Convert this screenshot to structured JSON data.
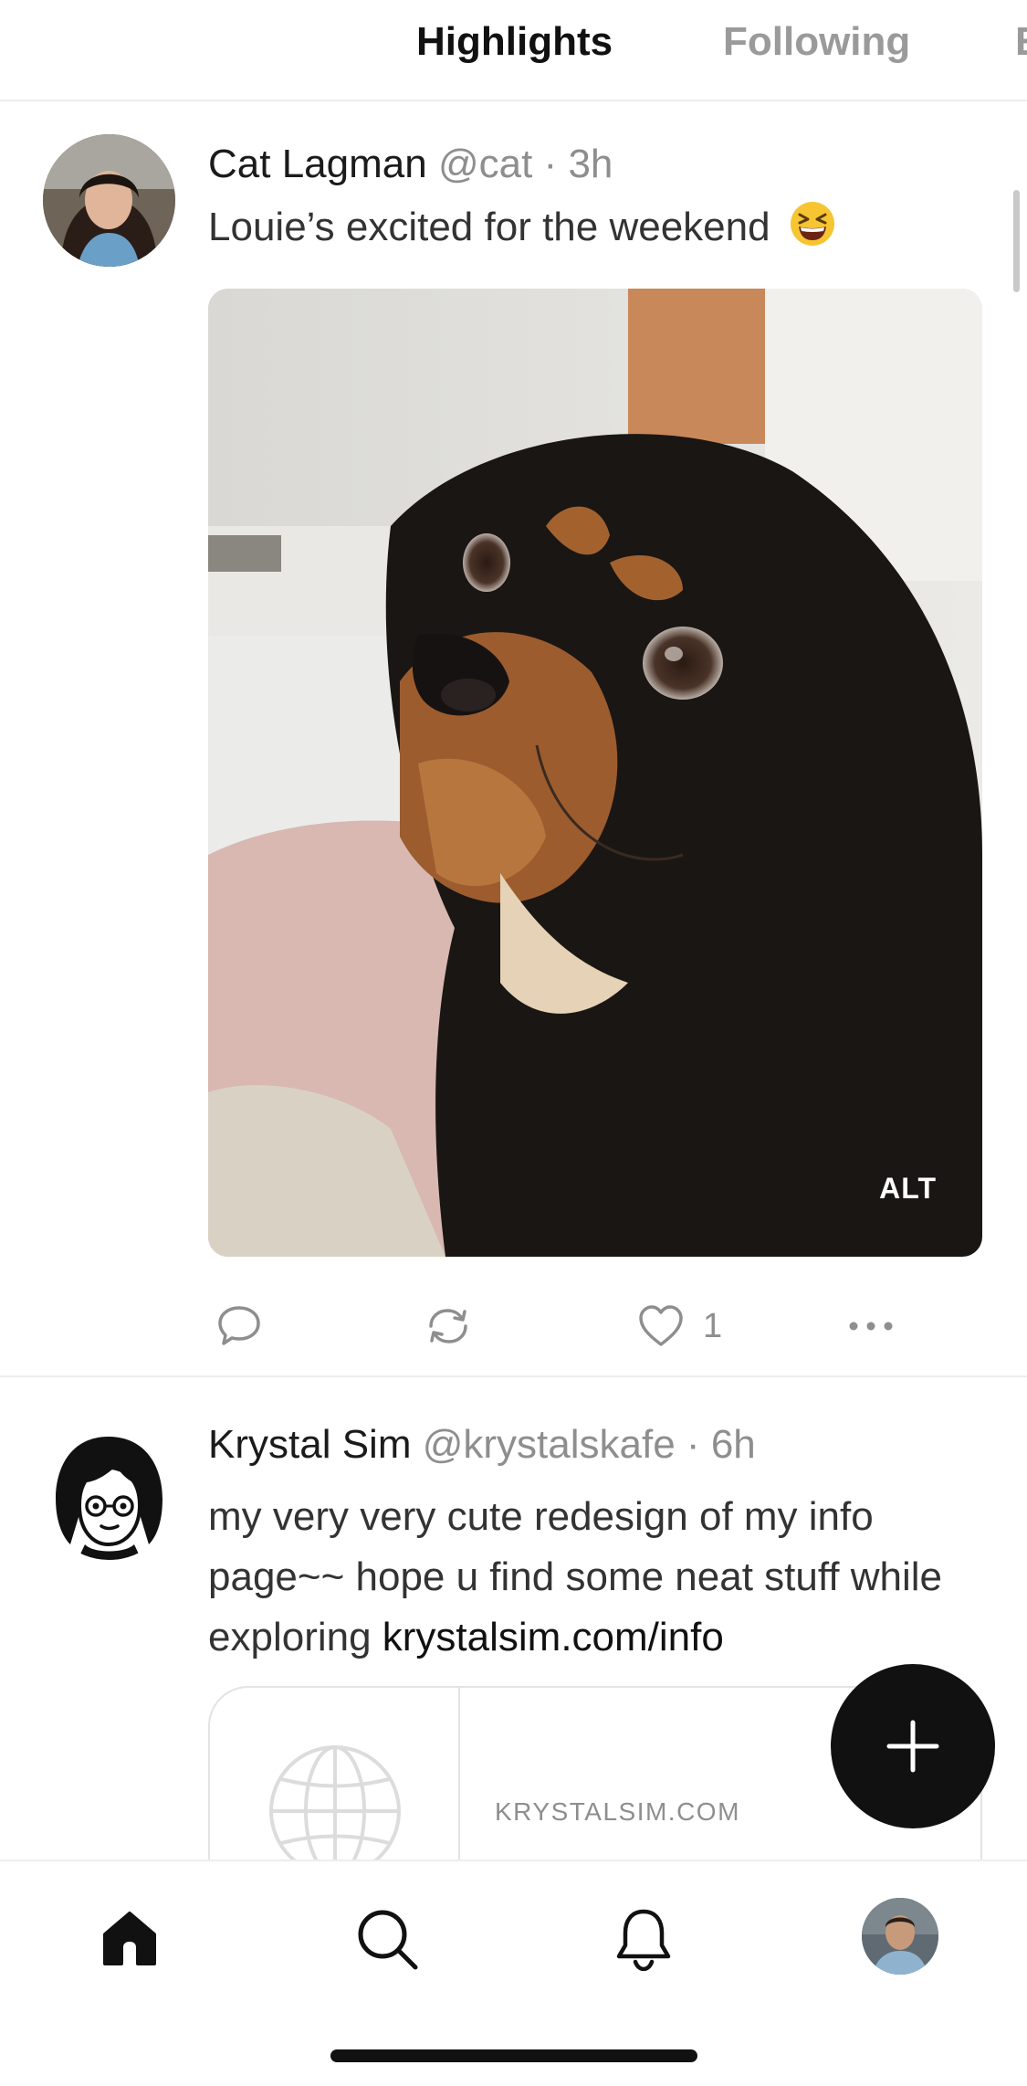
{
  "tabs": {
    "highlights": "Highlights",
    "following": "Following",
    "partial": "E"
  },
  "posts": [
    {
      "author": "Cat Lagman",
      "handle": "@cat",
      "time": "3h",
      "text": "Louie’s excited for the weekend",
      "emoji": "grinning-squinting-face-emoji",
      "image": {
        "subject": "dog-photo",
        "alt_badge": "ALT"
      },
      "likes": "1"
    },
    {
      "author": "Krystal Sim",
      "handle": "@krystalskafe",
      "time": "6h",
      "text": "my very very cute redesign of my info page~~ hope u find some neat stuff while exploring ",
      "link_text": "krystalsim.com/info",
      "link_card": {
        "domain": "KRYSTALSIM.COM",
        "icon": "globe-icon"
      }
    }
  ],
  "separator": "·",
  "nav": {
    "items": [
      "home-icon",
      "search-icon",
      "notifications-icon",
      "profile-avatar"
    ]
  },
  "colors": {
    "text_primary": "#1b1b1b",
    "text_secondary": "#8e8e8e",
    "divider": "#ededed",
    "fab": "#111111"
  }
}
